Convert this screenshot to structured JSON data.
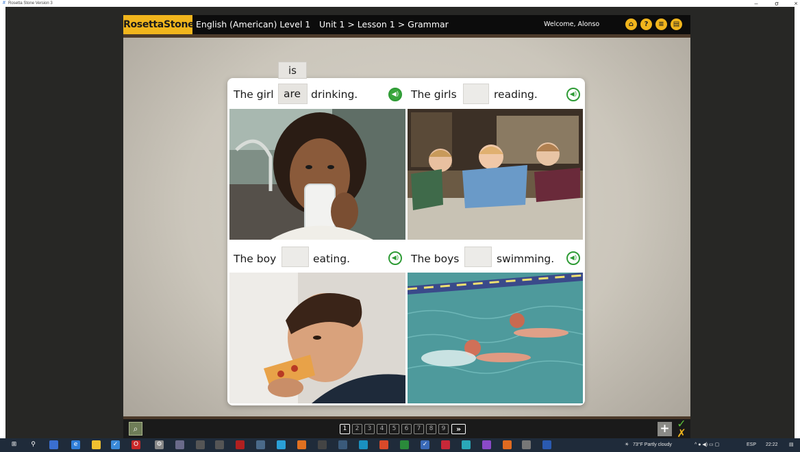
{
  "window": {
    "title": "Rosetta Stone Version 3",
    "controls": [
      "–",
      "σ",
      "×"
    ]
  },
  "header": {
    "logo": "RosettaStone",
    "course": "English (American) Level 1",
    "breadcrumb": "Unit 1 > Lesson 1 > Grammar",
    "welcome": "Welcome, Alonso",
    "icons": [
      "home-icon",
      "help-icon",
      "menu-icon",
      "chat-icon"
    ]
  },
  "exercise": {
    "drag_options": [
      "is",
      "are"
    ],
    "items": [
      {
        "subject": "The girl",
        "answer": "are",
        "rest": "drinking.",
        "photo": "girl drinking milk",
        "audio_active": true
      },
      {
        "subject": "The girls",
        "answer": "",
        "rest": "reading.",
        "photo": "girls reading books",
        "audio_active": false
      },
      {
        "subject": "The boy",
        "answer": "",
        "rest": "eating.",
        "photo": "boy eating pizza",
        "audio_active": false
      },
      {
        "subject": "The boys",
        "answer": "",
        "rest": "swimming.",
        "photo": "boys swimming",
        "audio_active": false
      }
    ]
  },
  "footer": {
    "pages": [
      "1",
      "2",
      "3",
      "4",
      "5",
      "6",
      "7",
      "8",
      "9"
    ],
    "current_page": 1,
    "next_label": "»",
    "plus_label": "+",
    "check_label": "✓",
    "cross_label": "✗"
  },
  "taskbar": {
    "weather": "73°F  Partly cloudy",
    "language": "ESP",
    "time": "22:22"
  },
  "colors": {
    "brand_yellow": "#f1b51c",
    "audio_green": "#3aa53d",
    "topbar": "#0c0c0c",
    "taskbar": "#1f2b3a"
  }
}
